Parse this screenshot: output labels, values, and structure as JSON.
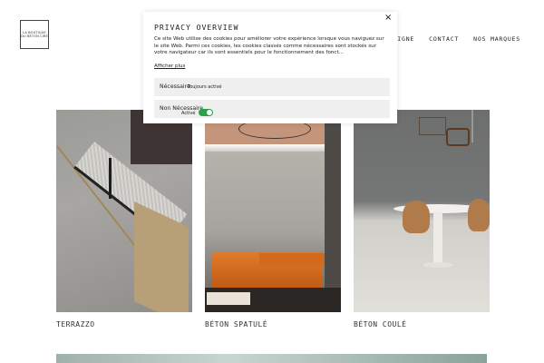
{
  "logo": {
    "line1": "LA BOUTIQUE",
    "line2": "DU BÉTON CIRÉ"
  },
  "nav": {
    "items": [
      "E EN LIGNE",
      "CONTACT",
      "NOS MARQUES"
    ]
  },
  "modal": {
    "title": "PRIVACY OVERVIEW",
    "body": "Ce site Web utilise des cookies pour améliorer votre expérience lorsque vous naviguez sur le site Web. Parmi ces cookies, les cookies classés comme nécessaires sont stockés sur votre navigateur car ils sont essentiels pour le fonctionnement des fonct...",
    "more": "Afficher plus",
    "close": "×",
    "rows": [
      {
        "label": "Nécessaire",
        "status": "Toujours activé"
      },
      {
        "label": "Non Nécessaire",
        "status": "Activé"
      }
    ]
  },
  "gallery": {
    "items": [
      {
        "caption": "TERRAZZO"
      },
      {
        "caption": "BÉTON SPATULÉ"
      },
      {
        "caption": "BÉTON COULÉ"
      }
    ]
  },
  "colors": {
    "toggle": "#2aa245",
    "card_caption": "#333333"
  }
}
